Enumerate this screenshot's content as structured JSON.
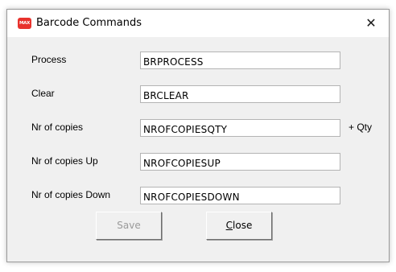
{
  "window": {
    "title": "Barcode Commands",
    "app_icon_text": "MAX",
    "close_glyph": "✕"
  },
  "form": {
    "fields": [
      {
        "label": "Process",
        "value": "BRPROCESS"
      },
      {
        "label": "Clear",
        "value": "BRCLEAR"
      },
      {
        "label": "Nr of copies",
        "value": "NROFCOPIESQTY"
      },
      {
        "label": "Nr of copies Up",
        "value": "NROFCOPIESUP"
      },
      {
        "label": "Nr of copies Down",
        "value": "NROFCOPIESDOWN"
      }
    ],
    "qty_suffix": "+ Qty"
  },
  "buttons": {
    "save_label": "Save",
    "close_mnemonic": "C",
    "close_rest": "lose"
  },
  "colors": {
    "app_icon": "#e8322d",
    "dialog_bg": "#f0f0f0",
    "disabled_text": "#9a9a9a"
  }
}
